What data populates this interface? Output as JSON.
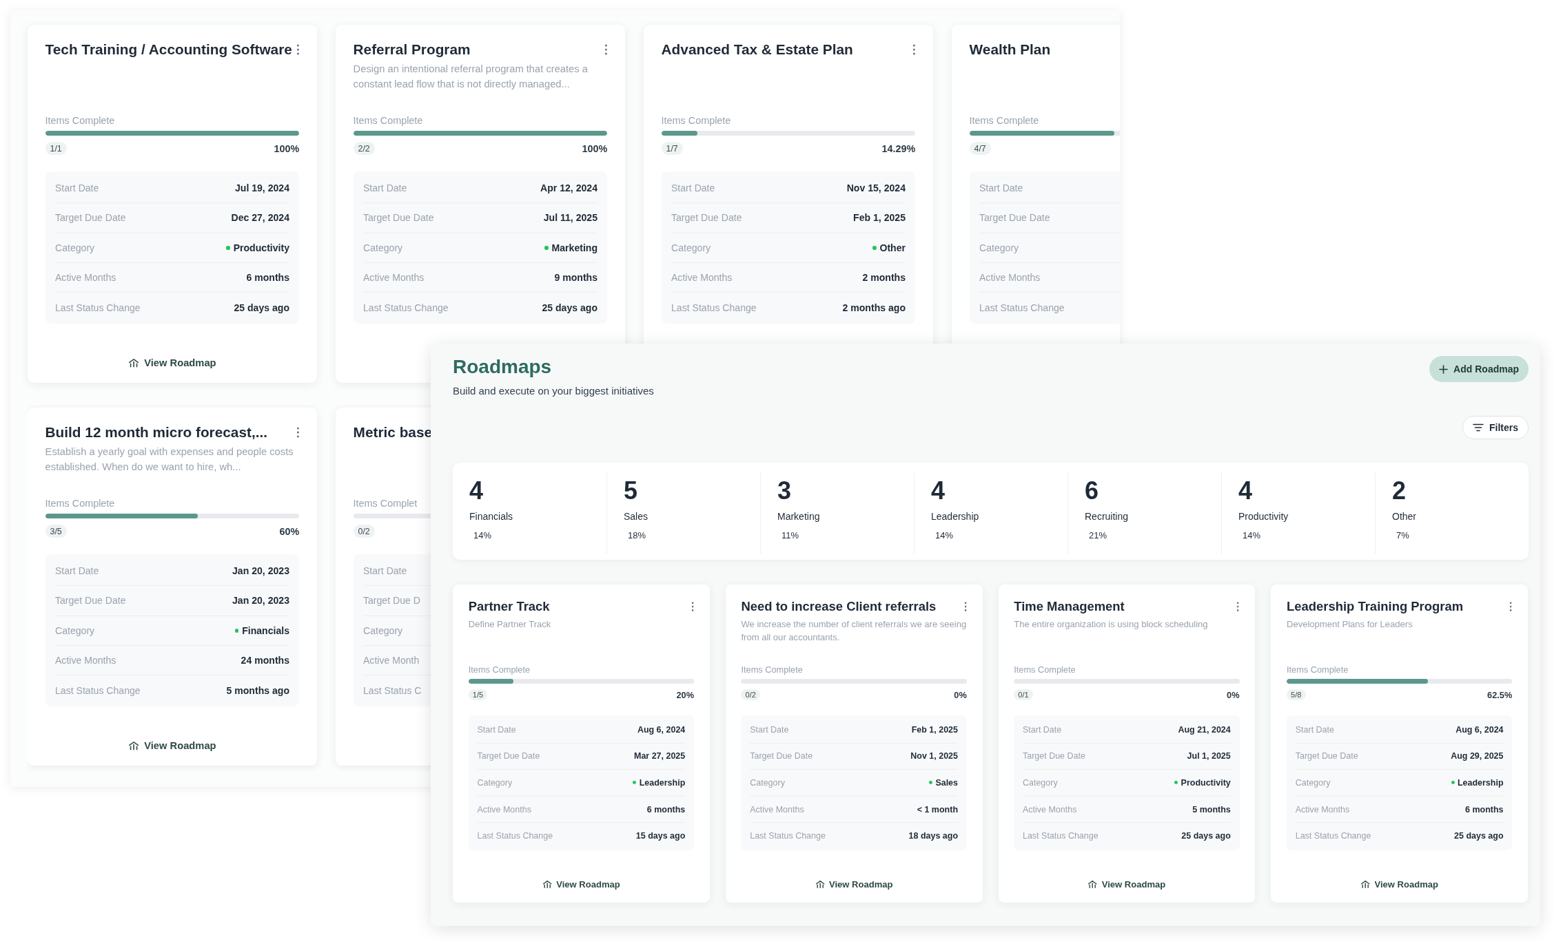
{
  "back_window": {
    "rows": [
      [
        {
          "title": "Tech Training / Accounting Software",
          "menu": true,
          "progress_label": "Items Complete",
          "level": 1,
          "count": "1/1",
          "percent": "100%",
          "details": [
            {
              "kind": "text",
              "label": "Start Date",
              "value": "Jul 19, 2024"
            },
            {
              "kind": "text",
              "label": "Target Due Date",
              "value": "Dec 27, 2024"
            },
            {
              "kind": "category",
              "label": "Category",
              "value": "Productivity"
            },
            {
              "kind": "text",
              "label": "Active Months",
              "value": "6 months"
            },
            {
              "kind": "text",
              "label": "Last Status Change",
              "value": "25 days ago"
            }
          ],
          "link": "View Roadmap"
        },
        {
          "title": "Referral Program",
          "menu": true,
          "description": "Design an intentional referral program that creates a constant lead flow that is not directly managed...",
          "progress_label": "Items Complete",
          "level": 1,
          "count": "2/2",
          "percent": "100%",
          "details": [
            {
              "kind": "text",
              "label": "Start Date",
              "value": "Apr 12, 2024"
            },
            {
              "kind": "text",
              "label": "Target Due Date",
              "value": "Jul 11, 2025"
            },
            {
              "kind": "category",
              "label": "Category",
              "value": "Marketing"
            },
            {
              "kind": "text",
              "label": "Active Months",
              "value": "9 months"
            },
            {
              "kind": "text",
              "label": "Last Status Change",
              "value": "25 days ago"
            }
          ]
        },
        {
          "title": "Advanced Tax & Estate Plan",
          "menu": true,
          "progress_label": "Items Complete",
          "level": 0.1429,
          "count": "1/7",
          "percent": "14.29%",
          "details": [
            {
              "kind": "text",
              "label": "Start Date",
              "value": "Nov 15, 2024"
            },
            {
              "kind": "text",
              "label": "Target Due Date",
              "value": "Feb 1, 2025"
            },
            {
              "kind": "category",
              "label": "Category",
              "value": "Other"
            },
            {
              "kind": "text",
              "label": "Active Months",
              "value": "2 months"
            },
            {
              "kind": "text",
              "label": "Last Status Change",
              "value": "2 months ago"
            }
          ]
        },
        {
          "title": "Wealth Plan",
          "menu": false,
          "progress_label": "Items Complete",
          "level": 0.5714,
          "count": "4/7",
          "details": [
            {
              "label": "Start Date"
            },
            {
              "label": "Target Due Date"
            },
            {
              "label": "Category"
            },
            {
              "label": "Active Months"
            },
            {
              "label": "Last Status Change"
            }
          ]
        }
      ],
      [
        {
          "title": "Build 12 month micro forecast,...",
          "menu": true,
          "description": "Establish a yearly goal with expenses and people costs established. When do we want to hire, wh...",
          "progress_label": "Items Complete",
          "level": 0.6,
          "count": "3/5",
          "percent": "60%",
          "details": [
            {
              "kind": "text",
              "label": "Start Date",
              "value": "Jan 20, 2023"
            },
            {
              "kind": "text",
              "label": "Target Due Date",
              "value": "Jan 20, 2023"
            },
            {
              "kind": "category",
              "label": "Category",
              "value": "Financials"
            },
            {
              "kind": "text",
              "label": "Active Months",
              "value": "24 months"
            },
            {
              "kind": "text",
              "label": "Last Status Change",
              "value": "5 months ago"
            }
          ],
          "link": "View Roadmap"
        },
        {
          "title": "Metric base",
          "menu": false,
          "progress_label": "Items Complet",
          "level": 0,
          "count": "0/2",
          "details": [
            {
              "label": "Start Date"
            },
            {
              "label": "Target Due D"
            },
            {
              "label": "Category"
            },
            {
              "label": "Active Month"
            },
            {
              "label": "Last Status C"
            }
          ]
        }
      ]
    ]
  },
  "front_window": {
    "title": "Roadmaps",
    "subtitle": "Build and execute on your biggest initiatives",
    "add_button": "Add Roadmap",
    "filters_button": "Filters",
    "stats": [
      {
        "count": "4",
        "label": "Financials",
        "percent": "14%"
      },
      {
        "count": "5",
        "label": "Sales",
        "percent": "18%"
      },
      {
        "count": "3",
        "label": "Marketing",
        "percent": "11%"
      },
      {
        "count": "4",
        "label": "Leadership",
        "percent": "14%"
      },
      {
        "count": "6",
        "label": "Recruiting",
        "percent": "21%"
      },
      {
        "count": "4",
        "label": "Productivity",
        "percent": "14%"
      },
      {
        "count": "2",
        "label": "Other",
        "percent": "7%"
      }
    ],
    "cards": [
      {
        "title": "Partner Track",
        "menu": true,
        "description": "Define Partner Track",
        "progress_label": "Items Complete",
        "level": 0.2,
        "count": "1/5",
        "percent": "20%",
        "details": [
          {
            "kind": "text",
            "label": "Start Date",
            "value": "Aug 6, 2024"
          },
          {
            "kind": "text",
            "label": "Target Due Date",
            "value": "Mar 27, 2025"
          },
          {
            "kind": "category",
            "label": "Category",
            "value": "Leadership"
          },
          {
            "kind": "text",
            "label": "Active Months",
            "value": "6 months"
          },
          {
            "kind": "text",
            "label": "Last Status Change",
            "value": "15 days ago"
          }
        ],
        "link": "View Roadmap"
      },
      {
        "title": "Need to increase Client referrals",
        "menu": true,
        "description": "We increase the number of client referrals we are seeing from all our accountants.",
        "progress_label": "Items Complete",
        "level": 0,
        "count": "0/2",
        "percent": "0%",
        "details": [
          {
            "kind": "text",
            "label": "Start Date",
            "value": "Feb 1, 2025"
          },
          {
            "kind": "text",
            "label": "Target Due Date",
            "value": "Nov 1, 2025"
          },
          {
            "kind": "category",
            "label": "Category",
            "value": "Sales"
          },
          {
            "kind": "text",
            "label": "Active Months",
            "value": "< 1 month"
          },
          {
            "kind": "text",
            "label": "Last Status Change",
            "value": "18 days ago"
          }
        ],
        "link": "View Roadmap"
      },
      {
        "title": "Time Management",
        "menu": true,
        "description": "The entire organization is using block scheduling",
        "progress_label": "Items Complete",
        "level": 0,
        "count": "0/1",
        "percent": "0%",
        "details": [
          {
            "kind": "text",
            "label": "Start Date",
            "value": "Aug 21, 2024"
          },
          {
            "kind": "text",
            "label": "Target Due Date",
            "value": "Jul 1, 2025"
          },
          {
            "kind": "category",
            "label": "Category",
            "value": "Productivity"
          },
          {
            "kind": "text",
            "label": "Active Months",
            "value": "5 months"
          },
          {
            "kind": "text",
            "label": "Last Status Change",
            "value": "25 days ago"
          }
        ],
        "link": "View Roadmap"
      },
      {
        "title": "Leadership Training Program",
        "menu": true,
        "description": "Development Plans for Leaders",
        "progress_label": "Items Complete",
        "level": 0.625,
        "count": "5/8",
        "percent": "62.5%",
        "details": [
          {
            "kind": "text",
            "label": "Start Date",
            "value": "Aug 6, 2024"
          },
          {
            "kind": "text",
            "label": "Target Due Date",
            "value": "Aug 29, 2025"
          },
          {
            "kind": "category",
            "label": "Category",
            "value": "Leadership"
          },
          {
            "kind": "text",
            "label": "Active Months",
            "value": "6 months"
          },
          {
            "kind": "text",
            "label": "Last Status Change",
            "value": "25 days ago"
          }
        ],
        "link": "View Roadmap"
      }
    ]
  }
}
